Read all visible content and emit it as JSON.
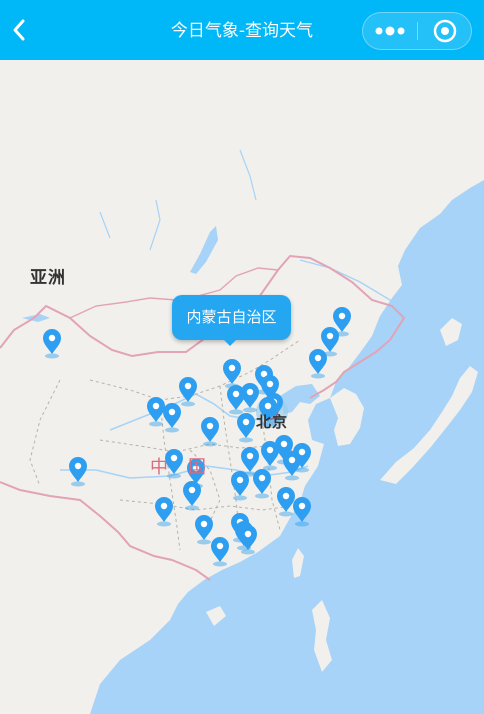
{
  "navbar": {
    "title": "今日气象-查询天气",
    "background": "#00b7f7",
    "back_icon": "chevron-left-icon",
    "more_icon": "more-dots-icon",
    "close_icon": "target-close-icon"
  },
  "map": {
    "labels": {
      "asia": "亚洲",
      "china": "中国",
      "beijing": "北京"
    },
    "callout": "内蒙古自治区",
    "marker_color": "#2e9ef0",
    "marker_icon": "location-pin-icon",
    "ocean_color": "#a6d3f7",
    "land_color": "#f1f0ec"
  }
}
